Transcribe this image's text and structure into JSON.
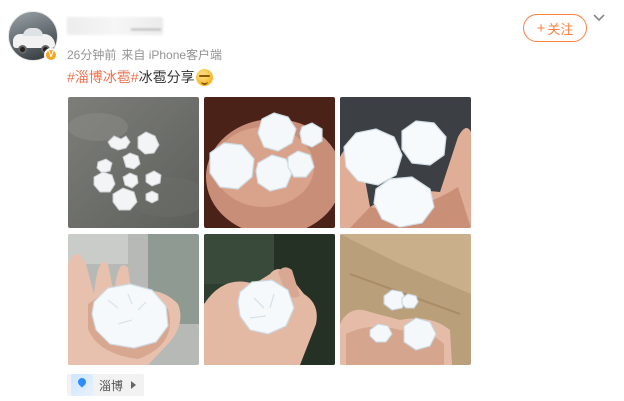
{
  "header": {
    "time": "26分钟前",
    "source": "来自 iPhone客户端",
    "follow_label": "关注"
  },
  "post": {
    "topic": "#淄博冰雹#",
    "text": "冰雹分享",
    "emoji": "smirk-emoji"
  },
  "photos": [
    {
      "subject": "hailstones-on-ground"
    },
    {
      "subject": "hailstones-in-palm-closeup"
    },
    {
      "subject": "hailstones-in-palm"
    },
    {
      "subject": "large-hailstone-in-palm"
    },
    {
      "subject": "hailstone-held-in-fingers"
    },
    {
      "subject": "hailstones-in-hand-over-box"
    }
  ],
  "location": {
    "label": "淄博"
  },
  "colors": {
    "accent": "#ff8140",
    "topic": "#eb7350",
    "meta": "#939393",
    "verified_badge": "#f5a623"
  },
  "icons": [
    "follow-plus-icon",
    "chevron-down-icon",
    "verified-badge-icon",
    "location-map-icon",
    "arrow-right-icon"
  ]
}
